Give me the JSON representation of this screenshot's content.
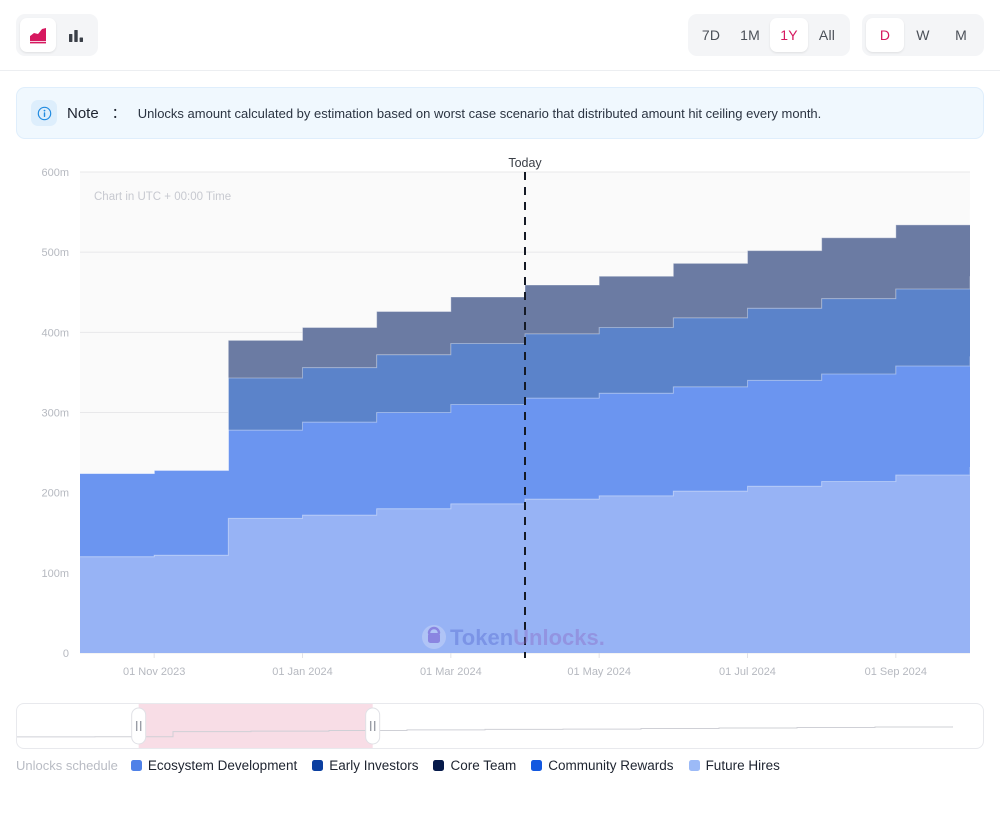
{
  "toolbar": {
    "chart_types": [
      {
        "id": "area-chart",
        "icon": "area-chart-icon",
        "active": true
      },
      {
        "id": "bar-chart",
        "icon": "bar-chart-icon",
        "active": false
      }
    ],
    "ranges": [
      {
        "label": "7D",
        "active": false
      },
      {
        "label": "1M",
        "active": false
      },
      {
        "label": "1Y",
        "active": true
      },
      {
        "label": "All",
        "active": false
      }
    ],
    "intervals": [
      {
        "label": "D",
        "active": true
      },
      {
        "label": "W",
        "active": false
      },
      {
        "label": "M",
        "active": false
      }
    ],
    "accent_color": "#d6185f"
  },
  "note": {
    "icon": "info-icon",
    "label": "Note",
    "colon": "：",
    "text": "Unlocks amount calculated by estimation based on worst case scenario that distributed amount hit ceiling every month."
  },
  "chart_annotations": {
    "today_label": "Today",
    "utc_note": "Chart in UTC + 00:00 Time",
    "watermark": {
      "prefix": "Token",
      "suffix": "Unlocks.",
      "icon": "unlock-padlock-icon"
    }
  },
  "legend": {
    "title": "Unlocks schedule",
    "items": [
      {
        "label": "Ecosystem Development",
        "color": "#4f81e8"
      },
      {
        "label": "Early Investors",
        "color": "#0b3fa0"
      },
      {
        "label": "Core Team",
        "color": "#061a4a"
      },
      {
        "label": "Community Rewards",
        "color": "#1358e0"
      },
      {
        "label": "Future Hires",
        "color": "#9cbaf7"
      }
    ]
  },
  "chart_data": {
    "type": "area",
    "title": "",
    "xlabel": "",
    "ylabel": "",
    "ylim": [
      0,
      600000000
    ],
    "yticks": [
      0,
      100000000,
      200000000,
      300000000,
      400000000,
      500000000,
      600000000
    ],
    "ytick_labels": [
      "0",
      "100m",
      "200m",
      "300m",
      "400m",
      "500m",
      "600m"
    ],
    "grid": true,
    "legend_position": "bottom",
    "stacked": true,
    "step": true,
    "xticks": [
      "01 Nov 2023",
      "01 Jan 2024",
      "01 Mar 2024",
      "01 May 2024",
      "01 Jul 2024",
      "01 Sep 2024"
    ],
    "x": [
      "2023-10-01",
      "2023-11-01",
      "2023-12-01",
      "2024-01-01",
      "2024-02-01",
      "2024-03-01",
      "2024-04-01",
      "2024-05-01",
      "2024-06-01",
      "2024-07-01",
      "2024-08-01",
      "2024-09-01",
      "2024-10-01"
    ],
    "today_x": "2024-04-01",
    "series": [
      {
        "name": "Future Hires",
        "color": "#97b3f5",
        "values": [
          120000000,
          122000000,
          168000000,
          172000000,
          180000000,
          186000000,
          192000000,
          196000000,
          202000000,
          208000000,
          214000000,
          222000000,
          232000000
        ]
      },
      {
        "name": "Community Rewards",
        "color": "#6b95f0",
        "values": [
          104000000,
          106000000,
          110000000,
          116000000,
          120000000,
          124000000,
          126000000,
          128000000,
          130000000,
          132000000,
          134000000,
          136000000,
          138000000
        ]
      },
      {
        "name": "Ecosystem Development",
        "color": "#5b83ca",
        "values": [
          0,
          0,
          65000000,
          68000000,
          72000000,
          76000000,
          80000000,
          82000000,
          86000000,
          90000000,
          94000000,
          96000000,
          100000000
        ]
      },
      {
        "name": "Core Team",
        "color": "#6b7ba3",
        "values": [
          0,
          0,
          47000000,
          50000000,
          54000000,
          58000000,
          61000000,
          64000000,
          68000000,
          72000000,
          76000000,
          80000000,
          84000000
        ]
      }
    ],
    "totals": [
      224000000,
      228000000,
      390000000,
      406000000,
      426000000,
      444000000,
      459000000,
      470000000,
      486000000,
      502000000,
      518000000,
      534000000,
      554000000
    ]
  },
  "brush": {
    "selection_start_pct": 13.0,
    "selection_end_pct": 38.0,
    "selection_color": "#f8dde6",
    "handle_icon": "drag-handle-icon"
  }
}
